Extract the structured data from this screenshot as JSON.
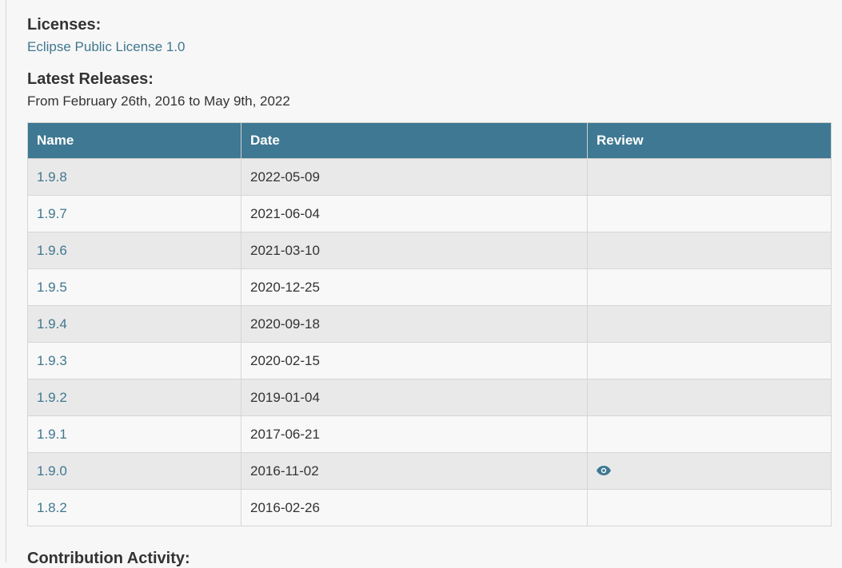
{
  "licenses": {
    "heading": "Licenses:",
    "link": "Eclipse Public License 1.0"
  },
  "releases": {
    "heading": "Latest Releases:",
    "range": "From February 26th, 2016 to May 9th, 2022",
    "columns": [
      "Name",
      "Date",
      "Review"
    ],
    "rows": [
      {
        "name": "1.9.8",
        "date": "2022-05-09",
        "review": ""
      },
      {
        "name": "1.9.7",
        "date": "2021-06-04",
        "review": ""
      },
      {
        "name": "1.9.6",
        "date": "2021-03-10",
        "review": ""
      },
      {
        "name": "1.9.5",
        "date": "2020-12-25",
        "review": ""
      },
      {
        "name": "1.9.4",
        "date": "2020-09-18",
        "review": ""
      },
      {
        "name": "1.9.3",
        "date": "2020-02-15",
        "review": ""
      },
      {
        "name": "1.9.2",
        "date": "2019-01-04",
        "review": ""
      },
      {
        "name": "1.9.1",
        "date": "2017-06-21",
        "review": ""
      },
      {
        "name": "1.9.0",
        "date": "2016-11-02",
        "review": "eye-icon"
      },
      {
        "name": "1.8.2",
        "date": "2016-02-26",
        "review": ""
      }
    ]
  },
  "next_section": {
    "heading": "Contribution Activity:"
  },
  "colors": {
    "header_bg": "#3e7893",
    "link": "#40778f",
    "row_odd": "#e9e9e9",
    "row_even": "#f8f8f8"
  }
}
